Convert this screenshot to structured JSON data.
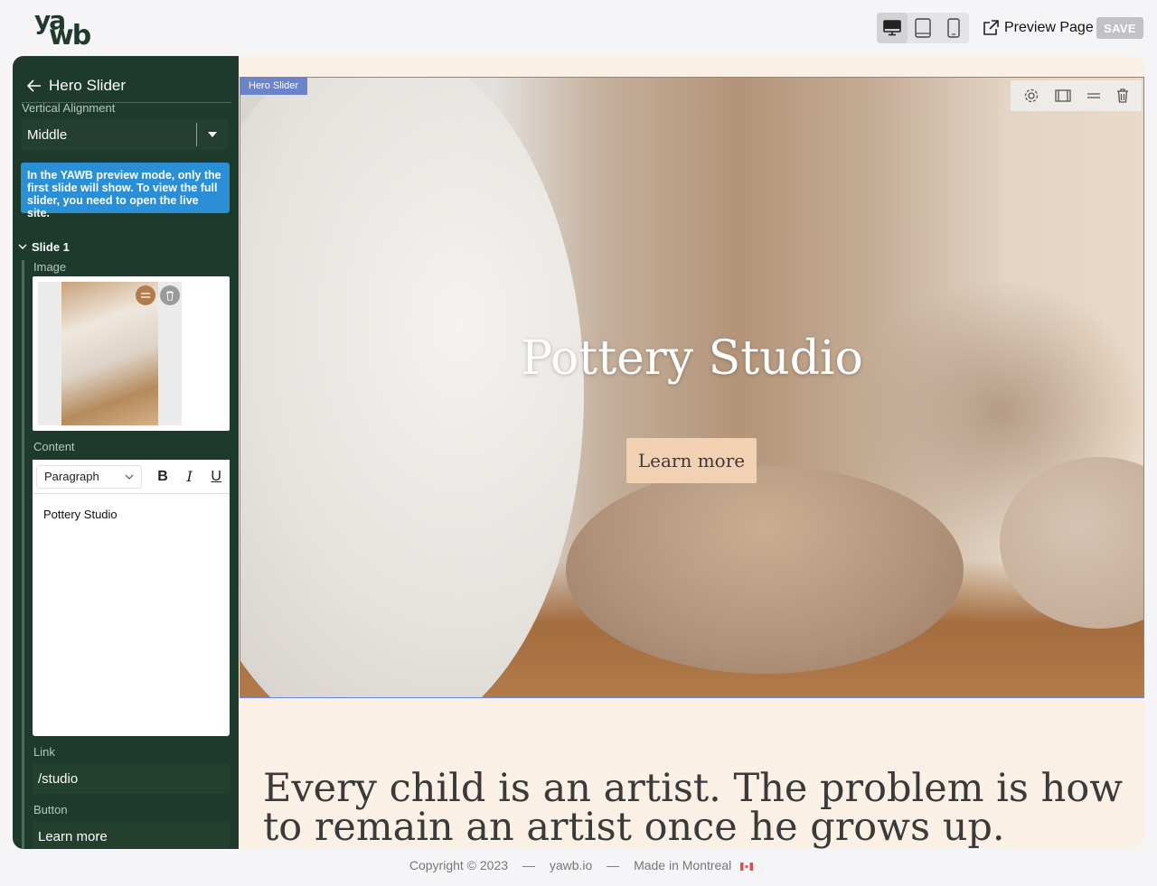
{
  "brand": {
    "logo_top": "ya",
    "logo_bottom": "wb"
  },
  "toolbar": {
    "devices": [
      {
        "name": "desktop",
        "icon": "desktop-icon",
        "active": true
      },
      {
        "name": "tablet",
        "icon": "tablet-icon",
        "active": false
      },
      {
        "name": "mobile",
        "icon": "mobile-icon",
        "active": false
      }
    ],
    "preview_label": "Preview Page",
    "save_label": "SAVE"
  },
  "sidebar": {
    "title": "Hero Slider",
    "vertical_alignment_label": "Vertical Alignment",
    "vertical_alignment_value": "Middle",
    "info": "In the YAWB preview mode, only the first slide will show. To view the full slider, you need to open the live site.",
    "slide": {
      "label": "Slide 1",
      "image_label": "Image",
      "content_label": "Content",
      "paragraph_select": "Paragraph",
      "format_bold": "B",
      "format_italic": "I",
      "format_underline": "U",
      "content_text": "Pottery Studio",
      "link_label": "Link",
      "link_value": "/studio",
      "button_label": "Button",
      "button_value": "Learn more"
    }
  },
  "hero": {
    "tag": "Hero Slider",
    "title": "Pottery Studio",
    "button": "Learn more"
  },
  "quote": "Every child is an artist. The problem is how to remain an artist once he grows up.",
  "footer": {
    "copyright": "Copyright © 2023",
    "site": "yawb.io",
    "made_in": "Made in Montreal",
    "sep": "—"
  },
  "colors": {
    "sidebar_bg": "#1e3a2c",
    "info_bg": "#2b8fd6",
    "page_bg": "#faf0e6",
    "hero_button_bg": "#f2d1b3",
    "tag_bg": "#6b84c9"
  }
}
